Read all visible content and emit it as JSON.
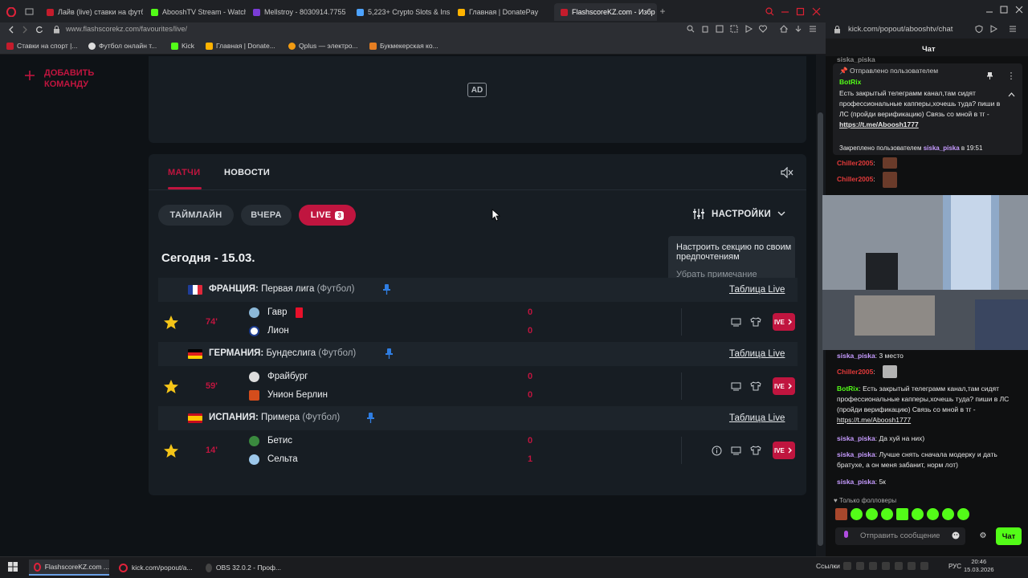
{
  "browser": {
    "tabs": [
      {
        "label": "Лайв (live) ставки на футб",
        "color": "#c41c2c"
      },
      {
        "label": "AbooshTV Stream - Watch",
        "color": "#53fc18"
      },
      {
        "label": "Mellstroy - 8030914.7755",
        "color": "#7a3cd6"
      },
      {
        "label": "5,223+ Crypto Slots & Insta",
        "color": "#4da3ff"
      },
      {
        "label": "Главная | DonatePay",
        "color": "#ffb300"
      },
      {
        "label": "FlashscoreKZ.com - Избр",
        "color": "#c41c2c",
        "active": true
      }
    ],
    "url": "www.flashscorekz.com/favourites/live/",
    "bookmarks": [
      {
        "label": "Ставки на спорт |...",
        "color": "#c41c2c"
      },
      {
        "label": "Футбол онлайн т...",
        "color": "#dddddd"
      },
      {
        "label": "Kick",
        "color": "#53fc18"
      },
      {
        "label": "Главная | Donate...",
        "color": "#ffb300"
      },
      {
        "label": "Qplus — электро...",
        "color": "#f39c12"
      },
      {
        "label": "Букмекерская ко...",
        "color": "#e67e22"
      }
    ]
  },
  "sidebar": {
    "add_team_line1": "ДОБАВИТЬ",
    "add_team_line2": "КОМАНДУ"
  },
  "ad": {
    "label": "AD"
  },
  "tabs": {
    "matches": "МАТЧИ",
    "news": "НОВОСТИ"
  },
  "filters": {
    "timeline": "ТАЙМЛАЙН",
    "yesterday": "ВЧЕРА",
    "live": "LIVE",
    "live_count": "3"
  },
  "settings": {
    "label": "НАСТРОЙКИ"
  },
  "tooltip": {
    "text": "Настроить секцию по своим предпочтениям",
    "dismiss": "Убрать примечание"
  },
  "date_header": "Сегодня - 15.03.",
  "leagues": [
    {
      "country": "ФРАНЦИЯ:",
      "name": "Первая лига",
      "sport": "(Футбол)",
      "table_link": "Таблица Live",
      "minute": "74'",
      "home": {
        "name": "Гавр",
        "score": "0",
        "red_card": true
      },
      "away": {
        "name": "Лион",
        "score": "0"
      }
    },
    {
      "country": "ГЕРМАНИЯ:",
      "name": "Бундеслига",
      "sport": "(Футбол)",
      "table_link": "Таблица Live",
      "minute": "59'",
      "home": {
        "name": "Фрайбург",
        "score": "0"
      },
      "away": {
        "name": "Унион Берлин",
        "score": "0"
      }
    },
    {
      "country": "ИСПАНИЯ:",
      "name": "Примера",
      "sport": "(Футбол)",
      "table_link": "Таблица Live",
      "minute": "14'",
      "home": {
        "name": "Бетис",
        "score": "0"
      },
      "away": {
        "name": "Сельта",
        "score": "1"
      }
    }
  ],
  "live_button": "IVE",
  "chat": {
    "url": "kick.com/popout/abooshtv/chat",
    "title": "Чат",
    "top_partial": "siska_piska",
    "pinned_by": "Отправлено пользователем",
    "pinned_user": "BotRix",
    "pinned_text": "Есть закрытый телеграмм канал,там сидят профессиональные капперы,хочешь туда? пиши в ЛС (пройди верификацию) Связь со мной в тг -",
    "pinned_link": "https://t.me/Aboosh1777",
    "pinned_footer_prefix": "Закреплено пользователем",
    "pinned_footer_user": "siska_piska",
    "pinned_footer_time": "в 19:51",
    "msgs_top": [
      {
        "user": "Chiller2005",
        "text": ":"
      },
      {
        "user": "Chiller2005",
        "text": ":"
      }
    ],
    "msgs": [
      {
        "user": "siska_piska",
        "text": ": 3 место"
      },
      {
        "user": "Chiller2005",
        "text": ":"
      },
      {
        "user": "BotRix",
        "text": ": Есть закрытый телеграмм канал,там сидят профессиональные капперы,хочешь туда? пиши в ЛС (пройди верификацию) Связь со мной в тг - ",
        "link": "https://t.me/Aboosh1777"
      },
      {
        "user": "siska_piska",
        "text": ": Да хуй на них)"
      },
      {
        "user": "siska_piska",
        "text": ": Лучше снять сначала модерку и дать братуxe, а он меня забанит, норм лот)"
      },
      {
        "user": "siska_piska",
        "text": ": 5к"
      }
    ],
    "followers_only": "Только фолловеры",
    "input_placeholder": "Отправить сообщение",
    "send": "Чат"
  },
  "taskbar": {
    "items": [
      {
        "label": "FlashscoreKZ.com ...",
        "active": true
      },
      {
        "label": "kick.com/popout/a...",
        "active": false
      },
      {
        "label": "OBS 32.0.2 - Проф...",
        "active": false
      }
    ],
    "tray_label": "Ссылки",
    "lang": "РУС",
    "time": "20:46",
    "date": "15.03.2026"
  },
  "colors": {
    "accent": "#c0153f",
    "kick_green": "#53fc18",
    "panel": "#171d23"
  }
}
